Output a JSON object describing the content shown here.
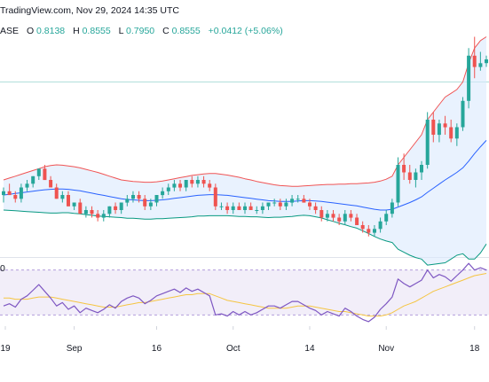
{
  "header": {
    "watermark": "TradingView.com, Nov 29, 2024 14:35 UTC",
    "symbol_suffix": "ASE",
    "ohlc": [
      {
        "label": "O",
        "value": "0.8138"
      },
      {
        "label": "H",
        "value": "0.8555"
      },
      {
        "label": "L",
        "value": "0.7950"
      },
      {
        "label": "C",
        "value": "0.8555"
      }
    ],
    "change": "+0.0412 (+5.06%)",
    "rsi_label": "0"
  },
  "colors": {
    "up": "#26a69a",
    "down": "#ef5350",
    "bb_upper": "#f05454",
    "bb_middle": "#2962ff",
    "bb_lower": "#089981",
    "bb_fill": "#dbeafe",
    "rsi_line": "#7e57c2",
    "rsi_ma": "#f5c542",
    "rsi_band": "#ede7f6",
    "header_value": "#26a69a",
    "axis_text": "#131722"
  },
  "chart_data": [
    {
      "type": "candlestick",
      "title": "",
      "x_axis_labels": [
        "19",
        "Sep",
        "16",
        "Oct",
        "14",
        "Nov",
        "18"
      ],
      "ohlc": [
        [
          0.6,
          0.62,
          0.58,
          0.61
        ],
        [
          0.61,
          0.63,
          0.6,
          0.6
        ],
        [
          0.6,
          0.61,
          0.58,
          0.59
        ],
        [
          0.59,
          0.63,
          0.58,
          0.62
        ],
        [
          0.62,
          0.64,
          0.61,
          0.63
        ],
        [
          0.63,
          0.65,
          0.62,
          0.65
        ],
        [
          0.65,
          0.67,
          0.64,
          0.67
        ],
        [
          0.67,
          0.68,
          0.64,
          0.64
        ],
        [
          0.64,
          0.65,
          0.62,
          0.62
        ],
        [
          0.62,
          0.63,
          0.59,
          0.59
        ],
        [
          0.59,
          0.61,
          0.58,
          0.6
        ],
        [
          0.6,
          0.61,
          0.57,
          0.57
        ],
        [
          0.57,
          0.58,
          0.56,
          0.58
        ],
        [
          0.58,
          0.59,
          0.55,
          0.55
        ],
        [
          0.55,
          0.57,
          0.54,
          0.56
        ],
        [
          0.56,
          0.57,
          0.54,
          0.55
        ],
        [
          0.55,
          0.56,
          0.53,
          0.54
        ],
        [
          0.54,
          0.56,
          0.53,
          0.55
        ],
        [
          0.55,
          0.57,
          0.54,
          0.57
        ],
        [
          0.57,
          0.58,
          0.55,
          0.56
        ],
        [
          0.56,
          0.58,
          0.55,
          0.58
        ],
        [
          0.58,
          0.6,
          0.57,
          0.59
        ],
        [
          0.59,
          0.61,
          0.58,
          0.6
        ],
        [
          0.6,
          0.61,
          0.58,
          0.59
        ],
        [
          0.59,
          0.6,
          0.56,
          0.57
        ],
        [
          0.57,
          0.59,
          0.56,
          0.58
        ],
        [
          0.58,
          0.6,
          0.57,
          0.6
        ],
        [
          0.6,
          0.62,
          0.59,
          0.61
        ],
        [
          0.61,
          0.63,
          0.6,
          0.62
        ],
        [
          0.62,
          0.64,
          0.61,
          0.63
        ],
        [
          0.63,
          0.64,
          0.61,
          0.62
        ],
        [
          0.62,
          0.64,
          0.61,
          0.64
        ],
        [
          0.64,
          0.65,
          0.62,
          0.63
        ],
        [
          0.63,
          0.65,
          0.62,
          0.64
        ],
        [
          0.64,
          0.65,
          0.62,
          0.63
        ],
        [
          0.63,
          0.64,
          0.61,
          0.62
        ],
        [
          0.62,
          0.63,
          0.56,
          0.57
        ],
        [
          0.57,
          0.58,
          0.56,
          0.57
        ],
        [
          0.57,
          0.58,
          0.55,
          0.56
        ],
        [
          0.56,
          0.58,
          0.55,
          0.57
        ],
        [
          0.57,
          0.58,
          0.56,
          0.56
        ],
        [
          0.56,
          0.58,
          0.55,
          0.57
        ],
        [
          0.57,
          0.58,
          0.56,
          0.56
        ],
        [
          0.56,
          0.57,
          0.55,
          0.56
        ],
        [
          0.56,
          0.58,
          0.55,
          0.57
        ],
        [
          0.57,
          0.58,
          0.56,
          0.58
        ],
        [
          0.58,
          0.59,
          0.57,
          0.58
        ],
        [
          0.58,
          0.59,
          0.56,
          0.57
        ],
        [
          0.57,
          0.59,
          0.56,
          0.58
        ],
        [
          0.58,
          0.6,
          0.57,
          0.59
        ],
        [
          0.59,
          0.6,
          0.58,
          0.59
        ],
        [
          0.59,
          0.6,
          0.58,
          0.58
        ],
        [
          0.58,
          0.59,
          0.56,
          0.57
        ],
        [
          0.57,
          0.58,
          0.55,
          0.56
        ],
        [
          0.56,
          0.57,
          0.53,
          0.54
        ],
        [
          0.54,
          0.56,
          0.53,
          0.55
        ],
        [
          0.55,
          0.56,
          0.53,
          0.54
        ],
        [
          0.54,
          0.55,
          0.52,
          0.53
        ],
        [
          0.53,
          0.56,
          0.52,
          0.55
        ],
        [
          0.55,
          0.56,
          0.53,
          0.54
        ],
        [
          0.54,
          0.55,
          0.52,
          0.52
        ],
        [
          0.52,
          0.53,
          0.5,
          0.51
        ],
        [
          0.51,
          0.52,
          0.49,
          0.5
        ],
        [
          0.5,
          0.52,
          0.49,
          0.51
        ],
        [
          0.51,
          0.54,
          0.5,
          0.53
        ],
        [
          0.53,
          0.56,
          0.52,
          0.55
        ],
        [
          0.55,
          0.59,
          0.54,
          0.58
        ],
        [
          0.58,
          0.7,
          0.57,
          0.68
        ],
        [
          0.68,
          0.71,
          0.64,
          0.66
        ],
        [
          0.66,
          0.68,
          0.63,
          0.64
        ],
        [
          0.64,
          0.67,
          0.62,
          0.66
        ],
        [
          0.66,
          0.69,
          0.64,
          0.68
        ],
        [
          0.68,
          0.82,
          0.67,
          0.8
        ],
        [
          0.8,
          0.82,
          0.74,
          0.76
        ],
        [
          0.76,
          0.8,
          0.74,
          0.79
        ],
        [
          0.79,
          0.81,
          0.76,
          0.78
        ],
        [
          0.78,
          0.8,
          0.74,
          0.75
        ],
        [
          0.75,
          0.79,
          0.73,
          0.78
        ],
        [
          0.78,
          0.86,
          0.77,
          0.85
        ],
        [
          0.85,
          0.99,
          0.83,
          0.97
        ],
        [
          0.97,
          1.02,
          0.91,
          0.94
        ],
        [
          0.94,
          0.98,
          0.93,
          0.95
        ],
        [
          0.95,
          0.97,
          0.94,
          0.96
        ]
      ],
      "bollinger_upper": [
        0.64,
        0.645,
        0.65,
        0.655,
        0.66,
        0.665,
        0.67,
        0.675,
        0.678,
        0.68,
        0.679,
        0.677,
        0.675,
        0.672,
        0.668,
        0.664,
        0.66,
        0.655,
        0.65,
        0.645,
        0.64,
        0.638,
        0.636,
        0.635,
        0.634,
        0.634,
        0.635,
        0.637,
        0.64,
        0.643,
        0.646,
        0.649,
        0.652,
        0.654,
        0.656,
        0.657,
        0.657,
        0.655,
        0.653,
        0.65,
        0.647,
        0.643,
        0.64,
        0.636,
        0.633,
        0.63,
        0.627,
        0.625,
        0.624,
        0.623,
        0.623,
        0.624,
        0.625,
        0.626,
        0.627,
        0.628,
        0.628,
        0.629,
        0.629,
        0.63,
        0.63,
        0.631,
        0.632,
        0.634,
        0.637,
        0.642,
        0.65,
        0.68,
        0.7,
        0.72,
        0.74,
        0.76,
        0.8,
        0.82,
        0.84,
        0.86,
        0.87,
        0.88,
        0.9,
        0.95,
        0.99,
        1.01,
        1.02
      ],
      "bollinger_middle": [
        0.6,
        0.602,
        0.604,
        0.606,
        0.608,
        0.61,
        0.612,
        0.614,
        0.615,
        0.616,
        0.616,
        0.615,
        0.613,
        0.611,
        0.608,
        0.605,
        0.602,
        0.599,
        0.596,
        0.593,
        0.59,
        0.588,
        0.587,
        0.586,
        0.585,
        0.585,
        0.586,
        0.587,
        0.589,
        0.591,
        0.593,
        0.595,
        0.597,
        0.599,
        0.6,
        0.601,
        0.601,
        0.6,
        0.599,
        0.597,
        0.595,
        0.593,
        0.591,
        0.589,
        0.587,
        0.585,
        0.584,
        0.583,
        0.583,
        0.583,
        0.584,
        0.585,
        0.585,
        0.584,
        0.583,
        0.581,
        0.579,
        0.577,
        0.575,
        0.573,
        0.571,
        0.568,
        0.565,
        0.562,
        0.56,
        0.56,
        0.562,
        0.568,
        0.574,
        0.58,
        0.587,
        0.595,
        0.607,
        0.618,
        0.629,
        0.64,
        0.65,
        0.66,
        0.672,
        0.69,
        0.71,
        0.728,
        0.745
      ],
      "bollinger_lower": [
        0.56,
        0.559,
        0.558,
        0.557,
        0.556,
        0.555,
        0.554,
        0.553,
        0.552,
        0.552,
        0.553,
        0.553,
        0.551,
        0.55,
        0.548,
        0.546,
        0.544,
        0.543,
        0.542,
        0.541,
        0.54,
        0.538,
        0.538,
        0.537,
        0.536,
        0.536,
        0.537,
        0.537,
        0.538,
        0.539,
        0.54,
        0.541,
        0.542,
        0.544,
        0.544,
        0.545,
        0.545,
        0.545,
        0.545,
        0.544,
        0.543,
        0.543,
        0.542,
        0.542,
        0.541,
        0.54,
        0.541,
        0.541,
        0.542,
        0.543,
        0.545,
        0.546,
        0.545,
        0.542,
        0.539,
        0.534,
        0.53,
        0.525,
        0.521,
        0.516,
        0.512,
        0.505,
        0.498,
        0.49,
        0.483,
        0.478,
        0.474,
        0.456,
        0.448,
        0.44,
        0.434,
        0.43,
        0.414,
        0.416,
        0.418,
        0.42,
        0.43,
        0.44,
        0.444,
        0.43,
        0.43,
        0.446,
        0.47
      ],
      "reference_line_price": 0.9,
      "y_range": [
        0.44,
        1.0
      ]
    },
    {
      "type": "line",
      "title": "",
      "series": [
        {
          "values": [
            38,
            40,
            37,
            44,
            47,
            52,
            57,
            51,
            45,
            38,
            41,
            35,
            38,
            32,
            36,
            34,
            32,
            35,
            39,
            36,
            42,
            45,
            47,
            45,
            40,
            43,
            47,
            49,
            51,
            53,
            50,
            54,
            51,
            53,
            50,
            47,
            30,
            31,
            29,
            33,
            30,
            33,
            30,
            32,
            35,
            38,
            38,
            36,
            39,
            42,
            42,
            39,
            36,
            34,
            30,
            33,
            31,
            29,
            36,
            33,
            29,
            26,
            24,
            28,
            35,
            40,
            46,
            62,
            58,
            55,
            58,
            61,
            70,
            63,
            66,
            64,
            60,
            65,
            70,
            76,
            70,
            72,
            70
          ]
        },
        {
          "values": [
            45,
            45,
            44,
            44,
            44,
            45,
            46,
            46,
            46,
            45,
            44,
            43,
            42,
            41,
            40,
            39,
            38,
            37,
            37,
            37,
            38,
            39,
            40,
            41,
            41,
            42,
            43,
            44,
            45,
            46,
            47,
            48,
            48,
            49,
            49,
            49,
            47,
            45,
            43,
            42,
            41,
            40,
            39,
            38,
            37,
            36,
            36,
            36,
            36,
            37,
            38,
            38,
            38,
            37,
            36,
            35,
            34,
            33,
            33,
            32,
            31,
            30,
            29,
            29,
            29,
            30,
            32,
            35,
            38,
            40,
            42,
            45,
            48,
            51,
            53,
            55,
            57,
            59,
            61,
            63,
            65,
            66,
            67
          ]
        }
      ],
      "band": [
        30,
        70
      ],
      "y_range": [
        20,
        80
      ]
    }
  ]
}
